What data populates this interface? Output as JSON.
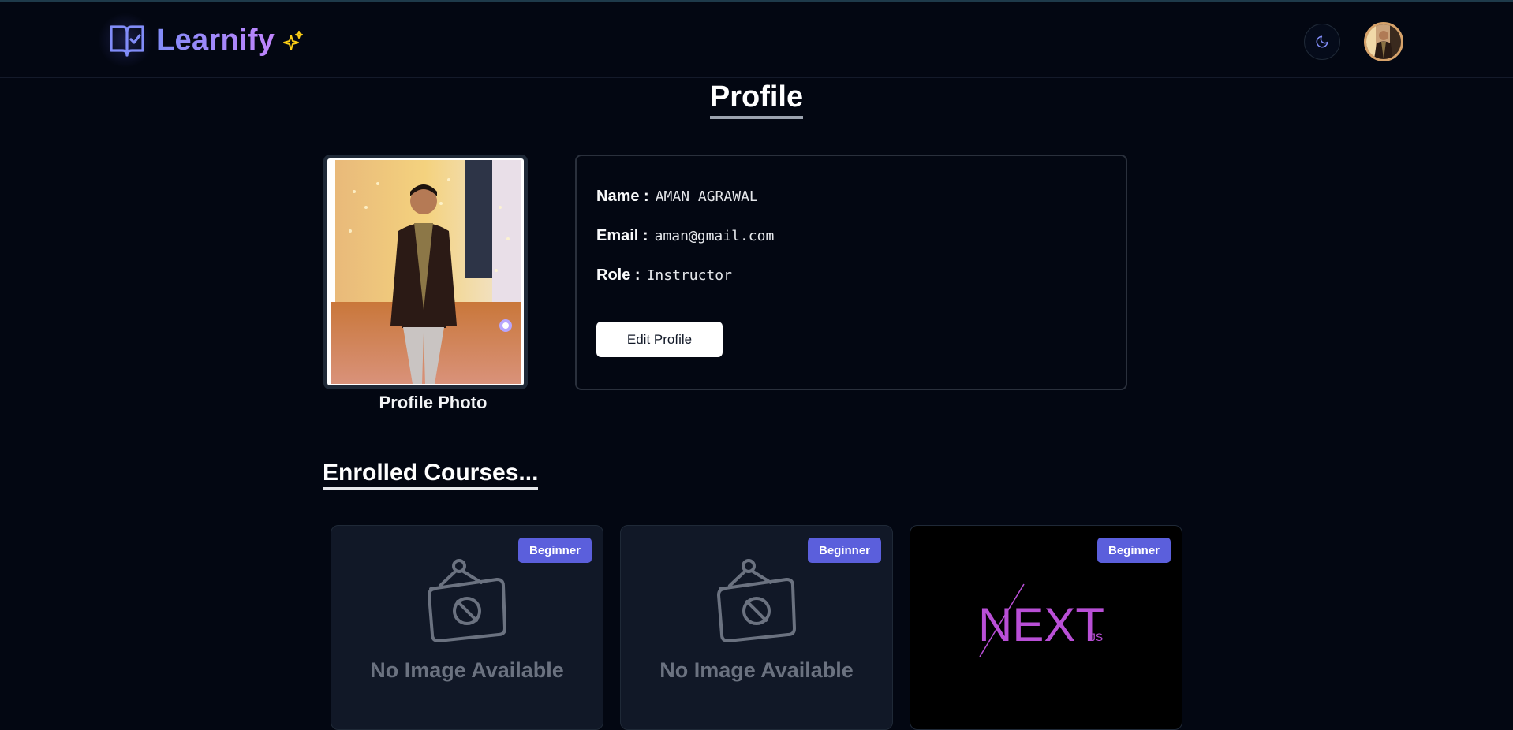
{
  "header": {
    "brand": "Learnify",
    "colors": {
      "brand_start": "#818cf8",
      "brand_end": "#c084fc",
      "sparkle": "#facc15"
    },
    "icons": {
      "logo": "book-check-icon",
      "sparkle": "sparkles-icon",
      "theme": "moon-icon",
      "avatar": "user-avatar"
    }
  },
  "page": {
    "title": "Profile"
  },
  "profile": {
    "photo_caption": "Profile Photo",
    "name_label": "Name :",
    "name_value": "AMAN AGRAWAL",
    "email_label": "Email :",
    "email_value": "aman@gmail.com",
    "role_label": "Role :",
    "role_value": "Instructor",
    "edit_button": "Edit Profile"
  },
  "enrolled": {
    "title": "Enrolled Courses...",
    "courses": [
      {
        "level": "Beginner",
        "thumbnail_text": "No Image Available",
        "thumbnail_icon": "image-off-icon"
      },
      {
        "level": "Beginner",
        "thumbnail_text": "No Image Available",
        "thumbnail_icon": "image-off-icon"
      },
      {
        "level": "Beginner",
        "thumbnail_logo": "NEXT",
        "thumbnail_logo_suffix": ".JS"
      }
    ],
    "colors": {
      "badge": "#5b5fdc",
      "card": "#111827"
    }
  }
}
